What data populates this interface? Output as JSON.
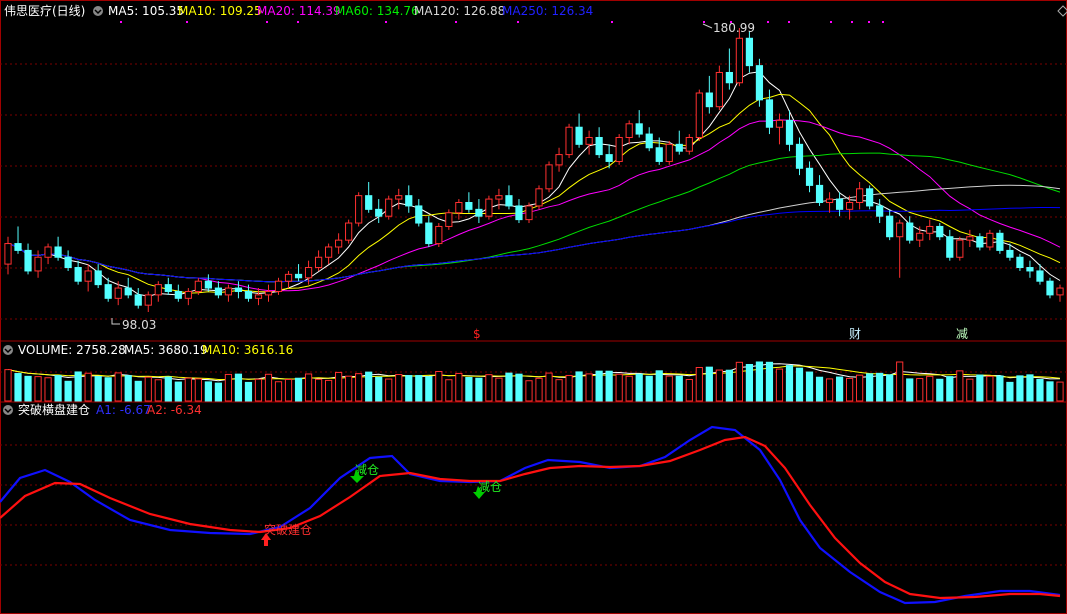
{
  "header": {
    "stock_name": "伟思医疗(日线)",
    "ma5_label": "MA5: 105.35",
    "ma10_label": "MA10: 109.25",
    "ma20_label": "MA20: 114.39",
    "ma60_label": "MA60: 134.76",
    "ma120_label": "MA120: 126.88",
    "ma250_label": "MA250: 126.34"
  },
  "price_panel": {
    "high_label": "180.99",
    "low_label": "98.03",
    "markers": [
      {
        "text": "$",
        "color": "#ff2020"
      },
      {
        "text": "财",
        "color": "#c8f0ff"
      },
      {
        "text": "减",
        "color": "#c0ffc0"
      }
    ]
  },
  "volume_panel": {
    "title": "VOLUME: 2758.28",
    "ma5_label": "MA5: 3680.19",
    "ma10_label": "MA10: 3616.16"
  },
  "indicator_panel": {
    "title": "突破横盘建仓",
    "a1_label": "A1: -6.67",
    "a2_label": "A2: -6.34",
    "signals": [
      {
        "text": "减仓",
        "type": "sell"
      },
      {
        "text": "减仓",
        "type": "sell"
      },
      {
        "text": "突破建仓",
        "type": "buy"
      }
    ]
  },
  "colors": {
    "up": "#ff3030",
    "down": "#54ffff",
    "ma5": "#ffffff",
    "ma10": "#ffff00",
    "ma20": "#ff00ff",
    "ma60": "#00dd00",
    "ma120": "#d0d0d0",
    "ma250": "#0000ff",
    "a1": "#1010ff",
    "a2": "#ff1010",
    "grid": "#7a0000"
  },
  "chart_data": [
    {
      "type": "candlestick",
      "title": "伟思医疗(日线)",
      "y_high": 180.99,
      "y_low": 98.03,
      "candles": [
        [
          112,
          120,
          109,
          118
        ],
        [
          118,
          123,
          115,
          116
        ],
        [
          116,
          118,
          109,
          110
        ],
        [
          110,
          116,
          108,
          114
        ],
        [
          114,
          118,
          112,
          117
        ],
        [
          117,
          120,
          113,
          114
        ],
        [
          114,
          116,
          110,
          111
        ],
        [
          111,
          113,
          106,
          107
        ],
        [
          107,
          112,
          104,
          110
        ],
        [
          110,
          112,
          105,
          106
        ],
        [
          106,
          108,
          101,
          102
        ],
        [
          102,
          107,
          100,
          105
        ],
        [
          105,
          108,
          102,
          103
        ],
        [
          103,
          105,
          99,
          100
        ],
        [
          100,
          104,
          98,
          103
        ],
        [
          103,
          107,
          101,
          106
        ],
        [
          106,
          108,
          103,
          104
        ],
        [
          104,
          106,
          101,
          102
        ],
        [
          102,
          105,
          100,
          104
        ],
        [
          104,
          108,
          103,
          107
        ],
        [
          107,
          109,
          104,
          105
        ],
        [
          105,
          107,
          102,
          103
        ],
        [
          103,
          106,
          101,
          105
        ],
        [
          105,
          107,
          102,
          104
        ],
        [
          104,
          106,
          101,
          102
        ],
        [
          102,
          105,
          100,
          103
        ],
        [
          103,
          106,
          101,
          104
        ],
        [
          104,
          108,
          103,
          107
        ],
        [
          107,
          110,
          105,
          109
        ],
        [
          109,
          112,
          107,
          108
        ],
        [
          108,
          113,
          106,
          111
        ],
        [
          111,
          116,
          110,
          114
        ],
        [
          114,
          118,
          112,
          117
        ],
        [
          117,
          121,
          115,
          119
        ],
        [
          119,
          125,
          118,
          124
        ],
        [
          124,
          133,
          123,
          132
        ],
        [
          132,
          136,
          127,
          128
        ],
        [
          128,
          131,
          124,
          126
        ],
        [
          126,
          132,
          125,
          131
        ],
        [
          131,
          134,
          128,
          132
        ],
        [
          132,
          135,
          127,
          129
        ],
        [
          129,
          131,
          123,
          124
        ],
        [
          124,
          126,
          117,
          118
        ],
        [
          118,
          124,
          117,
          123
        ],
        [
          123,
          128,
          122,
          127
        ],
        [
          127,
          131,
          125,
          130
        ],
        [
          130,
          133,
          127,
          128
        ],
        [
          128,
          131,
          124,
          126
        ],
        [
          126,
          132,
          125,
          131
        ],
        [
          131,
          134,
          128,
          132
        ],
        [
          132,
          135,
          128,
          129
        ],
        [
          129,
          131,
          124,
          125
        ],
        [
          125,
          130,
          124,
          129
        ],
        [
          129,
          135,
          128,
          134
        ],
        [
          134,
          142,
          133,
          141
        ],
        [
          141,
          146,
          139,
          144
        ],
        [
          144,
          153,
          143,
          152
        ],
        [
          152,
          156,
          146,
          147
        ],
        [
          147,
          151,
          144,
          149
        ],
        [
          149,
          152,
          143,
          144
        ],
        [
          144,
          147,
          140,
          142
        ],
        [
          142,
          150,
          141,
          149
        ],
        [
          149,
          154,
          147,
          153
        ],
        [
          153,
          157,
          149,
          150
        ],
        [
          150,
          152,
          145,
          146
        ],
        [
          146,
          149,
          141,
          142
        ],
        [
          142,
          148,
          141,
          147
        ],
        [
          147,
          151,
          144,
          145
        ],
        [
          145,
          150,
          144,
          149
        ],
        [
          149,
          163,
          148,
          162
        ],
        [
          162,
          167,
          156,
          158
        ],
        [
          158,
          170,
          157,
          168
        ],
        [
          168,
          175,
          163,
          165
        ],
        [
          165,
          181,
          164,
          178
        ],
        [
          178,
          180,
          168,
          170
        ],
        [
          170,
          172,
          158,
          160
        ],
        [
          160,
          163,
          150,
          152
        ],
        [
          152,
          156,
          147,
          154
        ],
        [
          154,
          157,
          145,
          147
        ],
        [
          147,
          149,
          138,
          140
        ],
        [
          140,
          142,
          133,
          135
        ],
        [
          135,
          138,
          129,
          130
        ],
        [
          130,
          133,
          127,
          131
        ],
        [
          131,
          133,
          126,
          128
        ],
        [
          128,
          132,
          125,
          130
        ],
        [
          130,
          136,
          128,
          134
        ],
        [
          134,
          135,
          128,
          129
        ],
        [
          129,
          131,
          124,
          126
        ],
        [
          126,
          128,
          119,
          120
        ],
        [
          120,
          125,
          108,
          124
        ],
        [
          124,
          126,
          118,
          119
        ],
        [
          119,
          123,
          117,
          121
        ],
        [
          121,
          125,
          119,
          123
        ],
        [
          123,
          124,
          119,
          120
        ],
        [
          120,
          122,
          113,
          114
        ],
        [
          114,
          120,
          113,
          119
        ],
        [
          119,
          122,
          117,
          120
        ],
        [
          120,
          121,
          116,
          117
        ],
        [
          117,
          122,
          116,
          121
        ],
        [
          121,
          122,
          115,
          116
        ],
        [
          116,
          118,
          113,
          114
        ],
        [
          114,
          115,
          110,
          111
        ],
        [
          111,
          113,
          108,
          110
        ],
        [
          110,
          112,
          106,
          107
        ],
        [
          107,
          108,
          102,
          103
        ],
        [
          103,
          106,
          101,
          105
        ]
      ]
    },
    {
      "type": "bar",
      "title": "VOLUME",
      "series": [
        {
          "name": "VOLUME",
          "last": 2758.28
        },
        {
          "name": "MA5",
          "last": 3680.19
        },
        {
          "name": "MA10",
          "last": 3616.16
        }
      ]
    },
    {
      "type": "line",
      "title": "突破横盘建仓",
      "series": [
        {
          "name": "A1",
          "last": -6.67
        },
        {
          "name": "A2",
          "last": -6.34
        }
      ]
    }
  ]
}
